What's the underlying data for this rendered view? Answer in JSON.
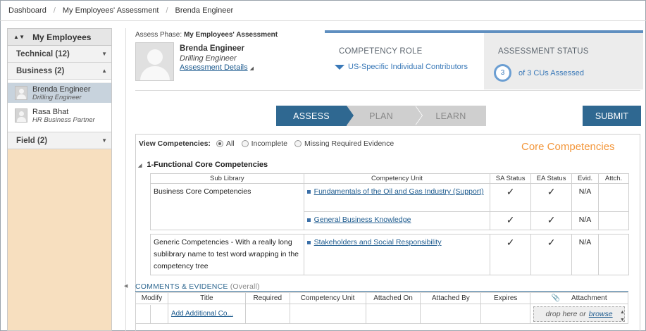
{
  "breadcrumb": [
    "Dashboard",
    "My Employees' Assessment",
    "Brenda Engineer"
  ],
  "sidebar": {
    "title": "My Employees",
    "groups": [
      {
        "label": "Technical (12)"
      },
      {
        "label": "Business (2)"
      },
      {
        "label": "Field (2)"
      }
    ],
    "employees": [
      {
        "name": "Brenda Engineer",
        "role": "Drilling Engineer"
      },
      {
        "name": "Rasa Bhat",
        "role": "HR Business Partner"
      }
    ]
  },
  "header": {
    "phase_label": "Assess Phase:",
    "phase_value": "My Employees' Assessment",
    "employee_name": "Brenda Engineer",
    "employee_role": "Drilling Engineer",
    "details_link": "Assessment Details"
  },
  "competency_role": {
    "title": "COMPETENCY ROLE",
    "value": "US-Specific Individual Contributors"
  },
  "assessment_status": {
    "title": "ASSESSMENT STATUS",
    "count": "3",
    "text": "of 3 CUs Assessed"
  },
  "steps": [
    "ASSESS",
    "PLAN",
    "LEARN"
  ],
  "submit_label": "SUBMIT",
  "view_filter": {
    "label": "View Competencies:",
    "options": [
      "All",
      "Incomplete",
      "Missing Required Evidence"
    ]
  },
  "section_title": "Core Competencies",
  "group_title": "1-Functional Core Competencies",
  "table": {
    "headers": [
      "Sub Library",
      "Competency Unit",
      "SA Status",
      "EA Status",
      "Evid.",
      "Attch."
    ],
    "rows": [
      {
        "sublib": "Business Core Competencies",
        "unit": "Fundamentals of the Oil and Gas Industry (Support)",
        "sa": "✓",
        "ea": "✓",
        "evid": "N/A"
      },
      {
        "sublib": "",
        "unit": "General Business Knowledge",
        "sa": "✓",
        "ea": "✓",
        "evid": "N/A"
      },
      {
        "sublib": "Generic Competencies - With a really long sublibrary name to test word wrapping in the competency tree",
        "unit": "Stakeholders and Social Responsibility",
        "sa": "✓",
        "ea": "✓",
        "evid": "N/A"
      }
    ]
  },
  "comments": {
    "title": "COMMENTS & EVIDENCE",
    "subtitle": "(Overall)",
    "headers": [
      "Modify",
      "Title",
      "Required",
      "Competency Unit",
      "Attached On",
      "Attached By",
      "Expires",
      "Attachment"
    ],
    "add_link": "Add Additional Co...",
    "drop_text": "drop here or",
    "browse": "browse"
  }
}
